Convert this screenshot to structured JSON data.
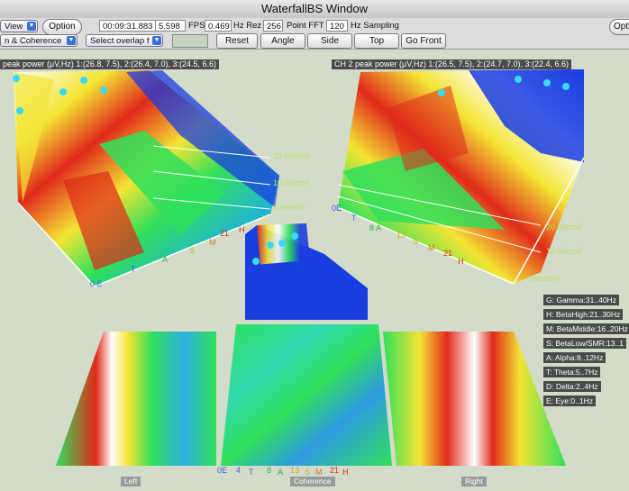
{
  "window": {
    "title": "WaterfallBS Window"
  },
  "toolbar": {
    "view_label": "View",
    "option_left_label": "Option",
    "elapsed": "00:09:31.883",
    "fps_value": "5.598",
    "fps_label": "FPS",
    "hz_rez_value": "0.469",
    "hz_rez_label": "Hz Rez",
    "fft_value": "256",
    "fft_label": "Point FFT",
    "sampling_value": "120",
    "sampling_label": "Hz Sampling",
    "option_right_label": "Opti",
    "mode_select": "n & Coherence",
    "overlap_select": "Select overlap f",
    "reset_label": "Reset",
    "angle_label": "Angle",
    "side_label": "Side",
    "top_label": "Top",
    "go_front_label": "Go Front"
  },
  "panels": {
    "ch1_peak": "peak power (μV,Hz) 1:(26.8, 7.5), 2:(26.4, 7.0), 3:(24.5, 6.6)",
    "ch2_peak": "CH 2 peak power (μV,Hz) 1:(26.5, 7.5), 2:(24.7, 7.0), 3:(22.4, 6.6)",
    "left_label": "Left",
    "coherence_label": "Coherence",
    "right_label": "Right"
  },
  "grid_labels": {
    "left_20": "20 microV",
    "left_10": "10 microV",
    "left_0": "0 microV",
    "right_20": "20 microV",
    "right_10": "10 microV",
    "right_0": "0 microV"
  },
  "band_markers": {
    "left": {
      "e": "0 E",
      "t": "T",
      "a": "A",
      "s": "S",
      "m": "M",
      "h": "H",
      "g": "G",
      "n21": "21"
    },
    "right": {
      "e": "0E",
      "t": "T",
      "a": "8 A",
      "s": "S",
      "m": "M",
      "h": "H",
      "n21": "21",
      "n13": "13"
    },
    "bottom": {
      "e": "0E",
      "d": "4",
      "t": "T",
      "n8": "8",
      "a": "A",
      "n13": "13",
      "s": "S",
      "m": "M",
      "h": "H",
      "n21": "21"
    }
  },
  "legend": [
    "G: Gamma:31..40Hz",
    "H: BetaHigh:21..30Hz",
    "M: BetaMiddle:16..20Hz",
    "S: BetaLow/SMR:13..1",
    "A: Alpha:8..12Hz",
    "T: Theta:5..7Hz",
    "D: Delta:2..4Hz",
    "E: Eye:0..1Hz"
  ],
  "colors": {
    "background": "#d3dcc9",
    "surface_blue": "#1a3de0",
    "surface_green": "#2fe05a",
    "surface_yellow": "#f4e534",
    "surface_red": "#e02a1a",
    "grid_label": "#b8e05a",
    "legend_bg": "#4a4a4a"
  }
}
